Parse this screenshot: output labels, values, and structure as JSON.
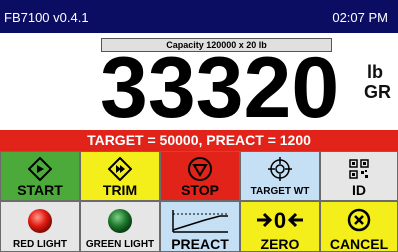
{
  "status": {
    "app_version": "FB7100 v0.4.1",
    "time": "02:07 PM"
  },
  "capacity_label": "Capacity 120000 x 20 lb",
  "weight": {
    "value": "33320",
    "unit": "lb",
    "mode": "GR"
  },
  "target_line": "TARGET = 50000, PREACT = 1200",
  "buttons_row1": {
    "start": "START",
    "trim": "TRIM",
    "stop": "STOP",
    "target_wt": "TARGET WT",
    "id": "ID"
  },
  "buttons_row2": {
    "red_light": "RED LIGHT",
    "green_light": "GREEN LIGHT",
    "preact": "PREACT",
    "zero": "ZERO",
    "cancel": "CANCEL"
  },
  "colors": {
    "statusbar": "#0b0d63",
    "banner_red": "#e2231a",
    "btn_green": "#4caa3a",
    "btn_yellow": "#f4ee1a",
    "btn_red": "#e2231a",
    "btn_lightblue": "#c5dff4",
    "btn_gray": "#e6e6e6"
  }
}
